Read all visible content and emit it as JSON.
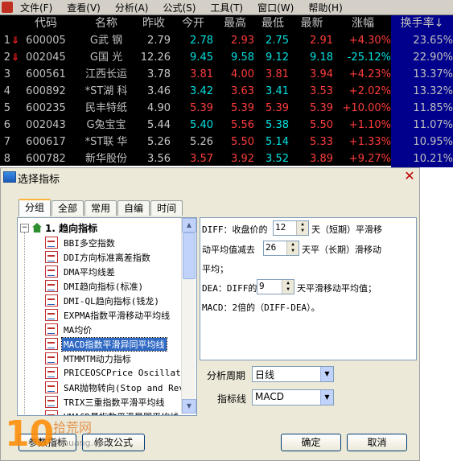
{
  "menubar": {
    "items": [
      "文件(F)",
      "查看(V)",
      "分析(A)",
      "公式(S)",
      "工具(T)",
      "窗口(W)",
      "帮助(H)"
    ]
  },
  "quotes": {
    "headers": {
      "code": "代码",
      "name": "名称",
      "prev": "昨收",
      "open": "今开",
      "high": "最高",
      "low": "最低",
      "last": "最新",
      "chg": "涨幅",
      "turn": "换手率↓"
    },
    "rows": [
      {
        "idx": "1",
        "arrow": "⇓",
        "code": "600005",
        "name": "G武 钢",
        "prev": "2.79",
        "open": "2.78",
        "high": "2.93",
        "low": "2.75",
        "last": "2.91",
        "chg": "+4.30%",
        "turn": "23.65%"
      },
      {
        "idx": "2",
        "arrow": "⇓",
        "code": "002045",
        "name": "G国 光",
        "prev": "12.26",
        "open": "9.45",
        "high": "9.58",
        "low": "9.12",
        "last": "9.18",
        "chg": "-25.12%",
        "turn": "22.90%"
      },
      {
        "idx": "3",
        "arrow": "",
        "code": "600561",
        "name": "江西长运",
        "prev": "3.78",
        "open": "3.81",
        "high": "4.00",
        "low": "3.81",
        "last": "3.94",
        "chg": "+4.23%",
        "turn": "13.37%"
      },
      {
        "idx": "4",
        "arrow": "",
        "code": "600892",
        "name": "*ST湖 科",
        "prev": "3.46",
        "open": "3.42",
        "high": "3.63",
        "low": "3.41",
        "last": "3.53",
        "chg": "+2.02%",
        "turn": "13.32%"
      },
      {
        "idx": "5",
        "arrow": "",
        "code": "600235",
        "name": "民丰特纸",
        "prev": "4.90",
        "open": "5.39",
        "high": "5.39",
        "low": "5.39",
        "last": "5.39",
        "chg": "+10.00%",
        "turn": "11.85%"
      },
      {
        "idx": "6",
        "arrow": "",
        "code": "002043",
        "name": "G兔宝宝",
        "prev": "5.44",
        "open": "5.40",
        "high": "5.56",
        "low": "5.38",
        "last": "5.50",
        "chg": "+1.10%",
        "turn": "11.07%"
      },
      {
        "idx": "7",
        "arrow": "",
        "code": "600617",
        "name": "*ST联 华",
        "prev": "5.26",
        "open": "5.26",
        "high": "5.50",
        "low": "5.14",
        "last": "5.33",
        "chg": "+1.33%",
        "turn": "10.95%"
      },
      {
        "idx": "8",
        "arrow": "",
        "code": "600782",
        "name": "新华股份",
        "prev": "3.56",
        "open": "3.57",
        "high": "3.92",
        "low": "3.52",
        "last": "3.89",
        "chg": "+9.27%",
        "turn": "10.21%"
      }
    ],
    "colors": {
      "up": "#ff3c3c",
      "down": "#00e0e0",
      "flat": "#c8c8c8"
    }
  },
  "dialog": {
    "title": "选择指标",
    "tabs": [
      "分组",
      "全部",
      "常用",
      "自编",
      "时间"
    ],
    "tree": {
      "root": "1. 趋向指标",
      "items": [
        "BBI多空指数",
        "DDI方向标准离差指数",
        "DMA平均线差",
        "DMI趋向指标(标准)",
        "DMI-QL趋向指标(钱龙)",
        "EXPMA指数平滑移动平均线",
        "MA均价",
        "MACD指数平滑异同平均线",
        "MTMMTM动力指标",
        "PRICEOSCPrice Oscillator",
        "SAR抛物转向(Stop and Rev",
        "TRIX三重指数平滑平均线",
        "VMACD量指数平滑异同平均线"
      ],
      "selected_index": 7
    },
    "params": {
      "line1_a": "DIFF：收盘价的",
      "diff_short": "12",
      "line1_b": "天（短期）平滑移",
      "line2_a": "动平均值减去",
      "diff_long": "26",
      "line2_b": "天平（长期）滑移动",
      "line3": "平均；",
      "line4_a": "DEA：DIFF的",
      "dea_n": "9",
      "line4_b": "天平滑移动平均值；",
      "line5": "MACD：2倍的（DIFF-DEA）。"
    },
    "period_label": "分析周期",
    "period_value": "日线",
    "line_label": "指标线",
    "line_value": "MACD",
    "buttons": {
      "left": "参数指标",
      "modify": "修改公式",
      "ok": "确定",
      "cancel": "取消"
    }
  },
  "watermark": {
    "logo": "10",
    "cn": "拾荒网",
    "en": "10huang.com"
  }
}
